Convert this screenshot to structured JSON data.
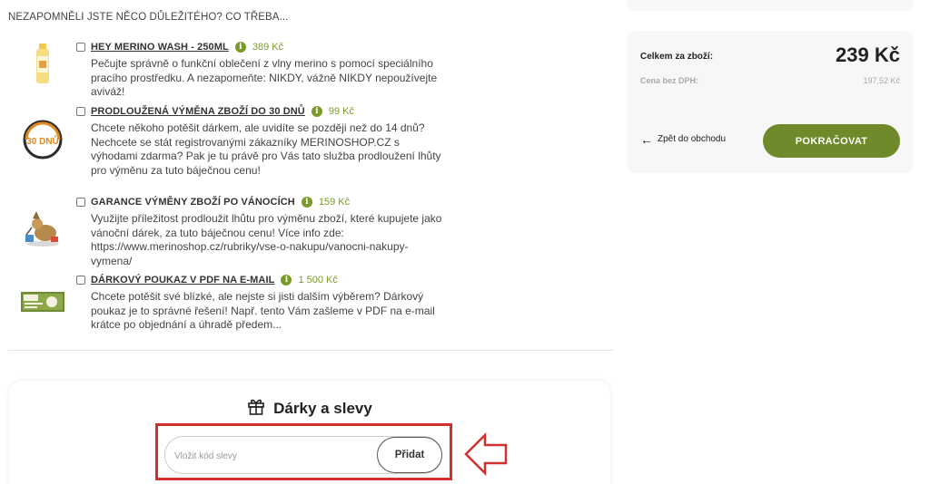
{
  "upsell": {
    "heading": "NEZAPOMNĚLI JSTE NĚCO DŮLEŽITÉHO? CO TŘEBA...",
    "items": [
      {
        "title": "HEY MERINO WASH - 250ML",
        "price": "389 Kč",
        "description": "Pečujte správně o funkční oblečení z vlny merino s pomocí speciálního pracího prostředku. A nezapomeňte: NIKDY, vážně NIKDY nepoužívejte aviváž!",
        "image_icon": "detergent-bottle"
      },
      {
        "title": "PRODLOUŽENÁ VÝMĚNA ZBOŽÍ DO 30 DNŮ",
        "price": "99 Kč",
        "description": "Chcete někoho potěšit dárkem, ale uvidíte se později než do 14 dnů? Nechcete se stát registrovanými zákazníky MERINOSHOP.CZ s výhodami zdarma? Pak je tu právě pro Vás tato služba prodloužení lhůty pro výměnu za tuto báječnou cenu!",
        "image_icon": "30-days-badge",
        "badge_text": "30 DNŮ"
      },
      {
        "title": "GARANCE VÝMĚNY ZBOŽÍ PO VÁNOCÍCH",
        "price": "159 Kč",
        "description": "Využijte příležitost prodloužit lhůtu pro výměnu zboží, které kupujete jako vánoční dárek, za tuto báječnou cenu! Více info zde: https://www.merinoshop.cz/rubriky/vse-o-nakupu/vanocni-nakupy-vymena/",
        "image_icon": "christmas-gift-illustration"
      },
      {
        "title": "DÁRKOVÝ POUKAZ V PDF NA E-MAIL",
        "price": "1 500 Kč",
        "description": "Chcete potěšit své blízké, ale nejste si jisti dalším výběrem? Dárkový poukaz je to správné řešení! Např. tento Vám zašleme v PDF na e-mail krátce po objednání a úhradě předem...",
        "image_icon": "gift-voucher-card"
      }
    ]
  },
  "gifts": {
    "title": "Dárky a slevy",
    "coupon_placeholder": "Vložit kód slevy",
    "add_label": "Přidat"
  },
  "summary": {
    "total_label": "Celkem za zboží:",
    "total_value": "239 Kč",
    "nett_label": "Cena bez DPH:",
    "nett_value": "197,52 Kč",
    "back_label": "Zpět do obchodu",
    "continue_label": "POKRAČOVAT"
  },
  "colors": {
    "accent_green": "#6e8a2a",
    "price_green": "#7a9a2b",
    "highlight_red": "#d32f2f"
  }
}
